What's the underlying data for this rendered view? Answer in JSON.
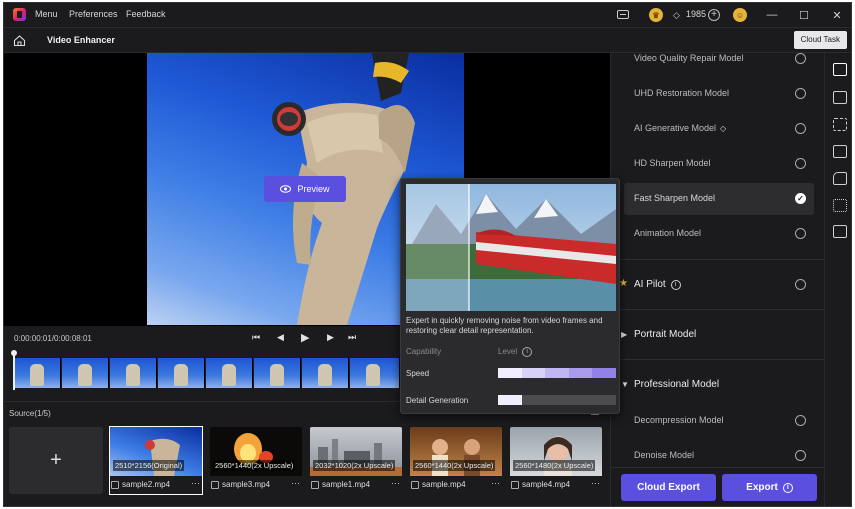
{
  "titlebar": {
    "menu": [
      "Menu",
      "Preferences",
      "Feedback"
    ],
    "points": "1985"
  },
  "header": {
    "title": "Video Enhancer",
    "cloud_task": "Cloud Task"
  },
  "preview": {
    "button_label": "Preview",
    "time": "0:00:00:01/0:00:08:01"
  },
  "source": {
    "label": "Source(1/5)",
    "add_symbol": "+",
    "items": [
      {
        "badge": "2510*2156(Original)",
        "name": "sample2.mp4",
        "selected": true
      },
      {
        "badge": "2560*1440(2x Upscale)",
        "name": "sample3.mp4",
        "selected": false
      },
      {
        "badge": "2032*1020(2x Upscale)",
        "name": "sample1.mp4",
        "selected": false
      },
      {
        "badge": "2560*1440(2x Upscale)",
        "name": "sample.mp4",
        "selected": false
      },
      {
        "badge": "2560*1480(2x Upscale)",
        "name": "sample4.mp4",
        "selected": false
      }
    ]
  },
  "models": {
    "general": [
      {
        "label": "Video Quality Repair Model"
      },
      {
        "label": "UHD Restoration Model"
      },
      {
        "label": "AI Generative Model",
        "premium": true
      },
      {
        "label": "HD Sharpen Model"
      },
      {
        "label": "Fast Sharpen Model",
        "selected": true
      },
      {
        "label": "Animation Model"
      }
    ],
    "ai_pilot": "AI Pilot",
    "portrait": "Portrait Model",
    "professional": "Professional Model",
    "professional_items": [
      {
        "label": "Decompression Model"
      },
      {
        "label": "Denoise Model"
      }
    ]
  },
  "buttons": {
    "cloud_export": "Cloud Export",
    "export": "Export"
  },
  "tooltip": {
    "description": "Expert in quickly removing noise from video frames and restoring clear detail representation.",
    "capability_header": "Capability",
    "level_header": "Level",
    "rows": [
      {
        "label": "Speed",
        "level": 5,
        "max": 5
      },
      {
        "label": "Detail Generation",
        "level": 1,
        "max": 5
      }
    ]
  },
  "colors": {
    "accent": "#5b4fe0",
    "background": "#1b1b1d",
    "active_row": "#2d2d30"
  }
}
